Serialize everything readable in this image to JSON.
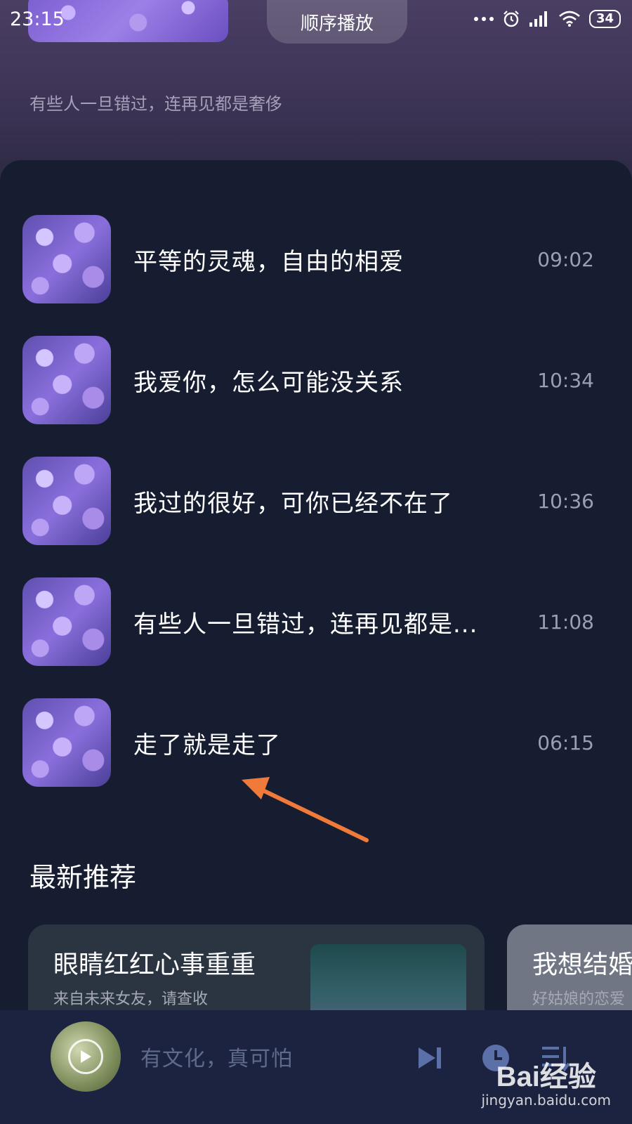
{
  "status_bar": {
    "time": "23:15",
    "battery": "34"
  },
  "header": {
    "mode_label": "顺序播放",
    "subtitle": "有些人一旦错过，连再见都是奢侈"
  },
  "songs": [
    {
      "title": "平等的灵魂，自由的相爱",
      "time": "09:02"
    },
    {
      "title": "我爱你，怎么可能没关系",
      "time": "10:34"
    },
    {
      "title": "我过的很好，可你已经不在了",
      "time": "10:36"
    },
    {
      "title": "有些人一旦错过，连再见都是...",
      "time": "11:08"
    },
    {
      "title": "走了就是走了",
      "time": "06:15"
    }
  ],
  "recommend": {
    "section_title": "最新推荐",
    "cards": [
      {
        "title": "眼睛红红心事重重",
        "subtitle": "来自未来女友，请查收"
      },
      {
        "title": "我想结婚",
        "subtitle": "好姑娘的恋爱"
      }
    ]
  },
  "player": {
    "now_playing": "有文化，真可怕"
  },
  "watermark": {
    "brand": "Bai经验",
    "url": "jingyan.baidu.com"
  },
  "colors": {
    "accent_arrow": "#f07a3a",
    "background": "#171d31",
    "header_top": "#4a3e63"
  }
}
